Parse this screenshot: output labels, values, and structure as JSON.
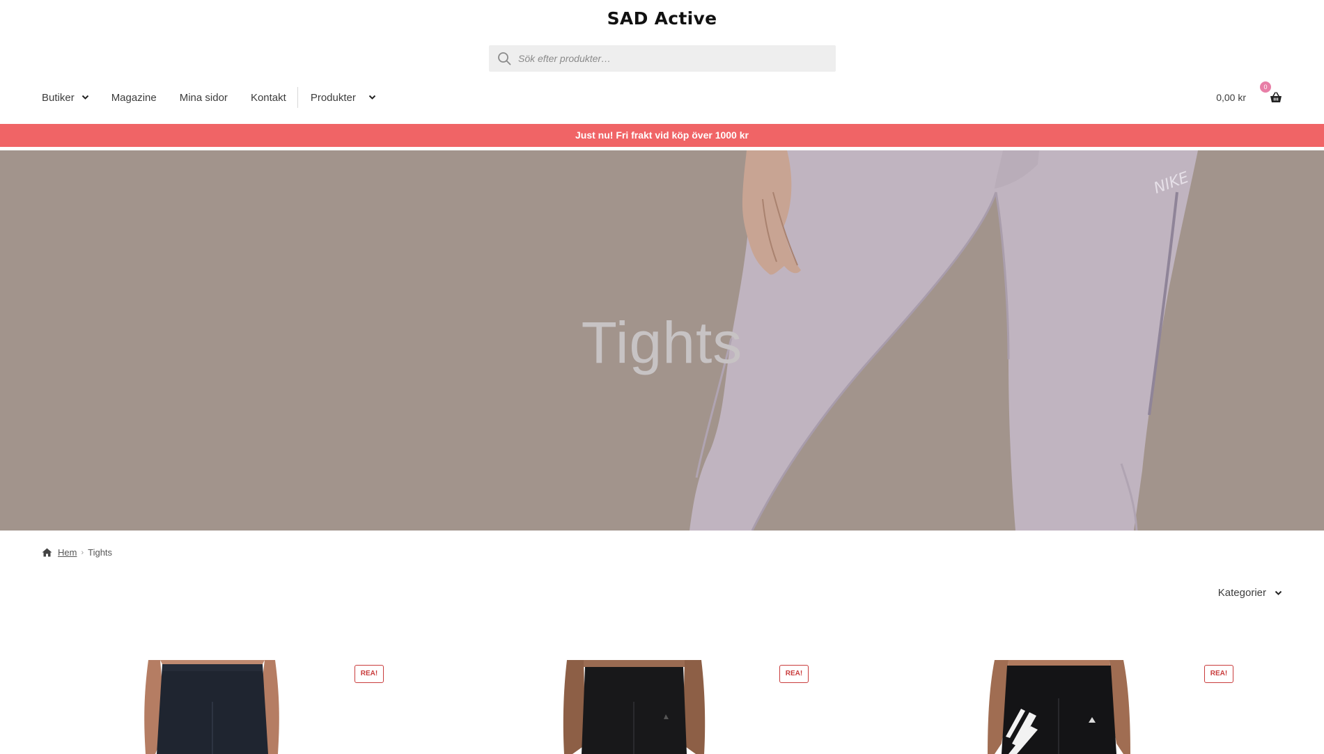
{
  "header": {
    "site_title": "SAD Active",
    "search": {
      "placeholder": "Sök efter produkter…"
    }
  },
  "nav": {
    "items": [
      {
        "label": "Butiker",
        "has_dropdown": true
      },
      {
        "label": "Magazine",
        "has_dropdown": false
      },
      {
        "label": "Mina sidor",
        "has_dropdown": false
      },
      {
        "label": "Kontakt",
        "has_dropdown": false
      },
      {
        "label": "Produkter",
        "has_dropdown": true
      }
    ]
  },
  "cart": {
    "total": "0,00 kr",
    "count": "0",
    "icon": "basket-icon"
  },
  "promo": {
    "text": "Just nu! Fri frakt vid köp över 1000 kr"
  },
  "hero": {
    "title": "Tights"
  },
  "breadcrumb": {
    "home": "Hem",
    "current": "Tights",
    "icon": "home-icon"
  },
  "sort": {
    "label": "Kategorier"
  },
  "products": [
    {
      "badge": "REA!"
    },
    {
      "badge": "REA!"
    },
    {
      "badge": "REA!"
    }
  ],
  "colors": {
    "promo": "#f06466",
    "hero_bg": "#a2948c",
    "badge": "#c93b3b",
    "cart_count": "#e87fa7"
  }
}
